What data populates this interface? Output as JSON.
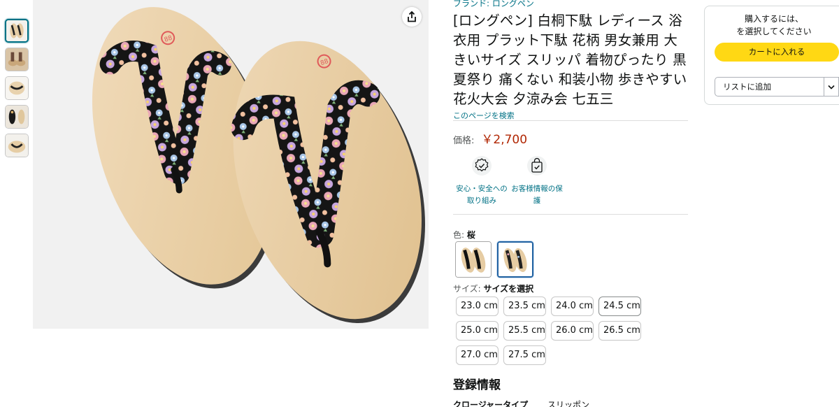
{
  "brand_link": "ブランド: ロングペン",
  "title": "[ロングペン] 白桐下駄 レディース 浴衣用 プラット下駄 花柄 男女兼用 大きいサイズ スリッパ 着物ぴったり 黒 夏祭り 痛くない 和装小物 歩きやすい 花火大会 夕涼み会 七五三",
  "search_page_link": "このページを検索",
  "price": {
    "label": "価格:",
    "value": "￥2,700"
  },
  "badges": [
    {
      "icon": "safety-badge-icon",
      "label": "安心・安全への取り組み"
    },
    {
      "icon": "privacy-bag-icon",
      "label": "お客様情報の保護"
    }
  ],
  "color": {
    "label": "色:",
    "selected": "桜"
  },
  "size": {
    "label": "サイズ:",
    "selected": "サイズを選択",
    "options": [
      "23.0 cm",
      "23.5 cm",
      "24.0 cm",
      "24.5 cm",
      "25.0 cm",
      "25.5 cm",
      "26.0 cm",
      "26.5 cm",
      "27.0 cm",
      "27.5 cm"
    ]
  },
  "registration": {
    "heading": "登録情報",
    "spec_key": "クロージャータイプ",
    "spec_value": "スリッポン"
  },
  "buybox": {
    "message_line1": "購入するには、",
    "message_line2": "を選択してください",
    "cart_button": "カートに入れる",
    "list_button": "リストに追加"
  },
  "colors": {
    "link": "#007185",
    "price": "#b12704",
    "cart_button": "#ffd814",
    "selected_swatch": "#2162a1"
  }
}
